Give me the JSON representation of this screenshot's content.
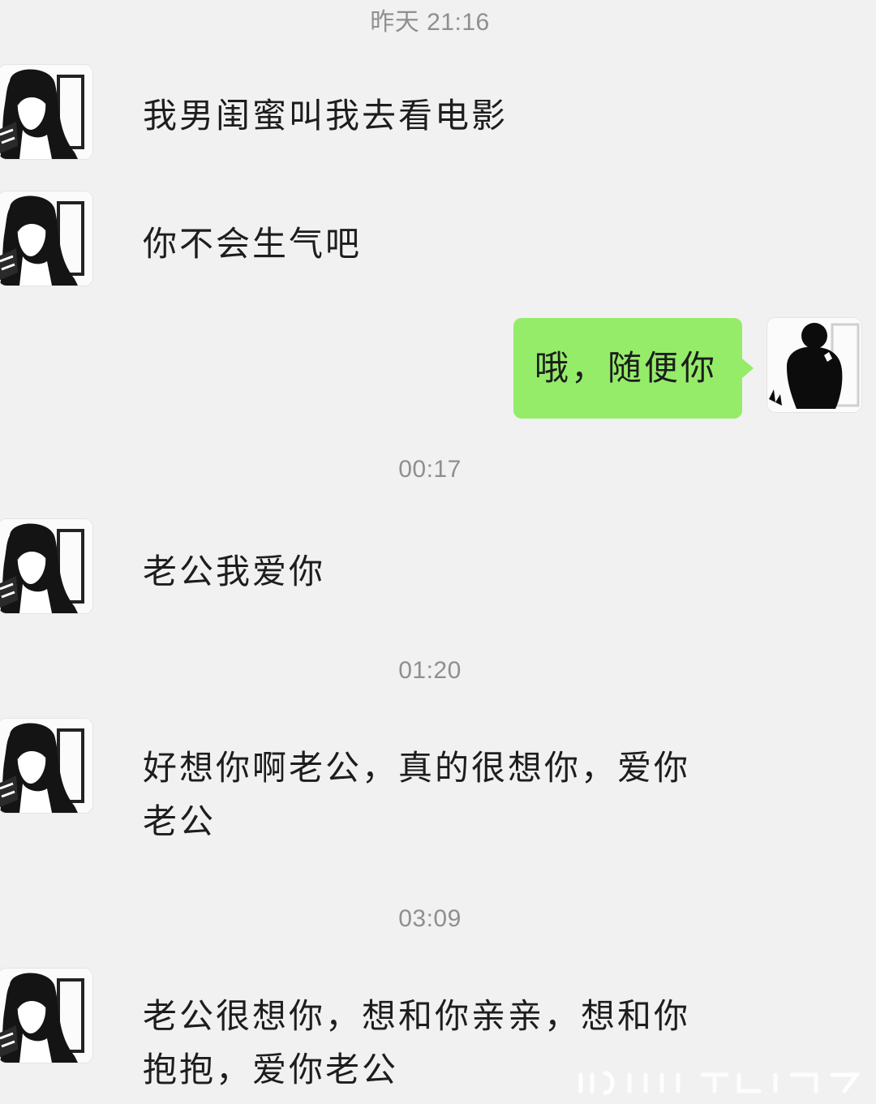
{
  "chat": {
    "timestamps": [
      "昨天 21:16",
      "00:17",
      "01:20",
      "03:09"
    ],
    "messages": [
      {
        "sender": "contact",
        "text": "我男闺蜜叫我去看电影"
      },
      {
        "sender": "contact",
        "text": "你不会生气吧"
      },
      {
        "sender": "self",
        "text": "哦，随便你"
      },
      {
        "sender": "contact",
        "text": "老公我爱你"
      },
      {
        "sender": "contact",
        "lines": [
          "好想你啊老公，真的很想你，爱你",
          "老公"
        ]
      },
      {
        "sender": "contact",
        "lines": [
          "老公很想你，想和你亲亲，想和你",
          "抱抱，爱你老公"
        ]
      }
    ]
  },
  "colors": {
    "background": "#f1f1f1",
    "self_bubble": "#95ec69",
    "timestamp_text": "#8f8f8f"
  },
  "icons": {
    "contact_avatar": "anime-girl-avatar",
    "self_avatar": "silhouette-avatar"
  }
}
